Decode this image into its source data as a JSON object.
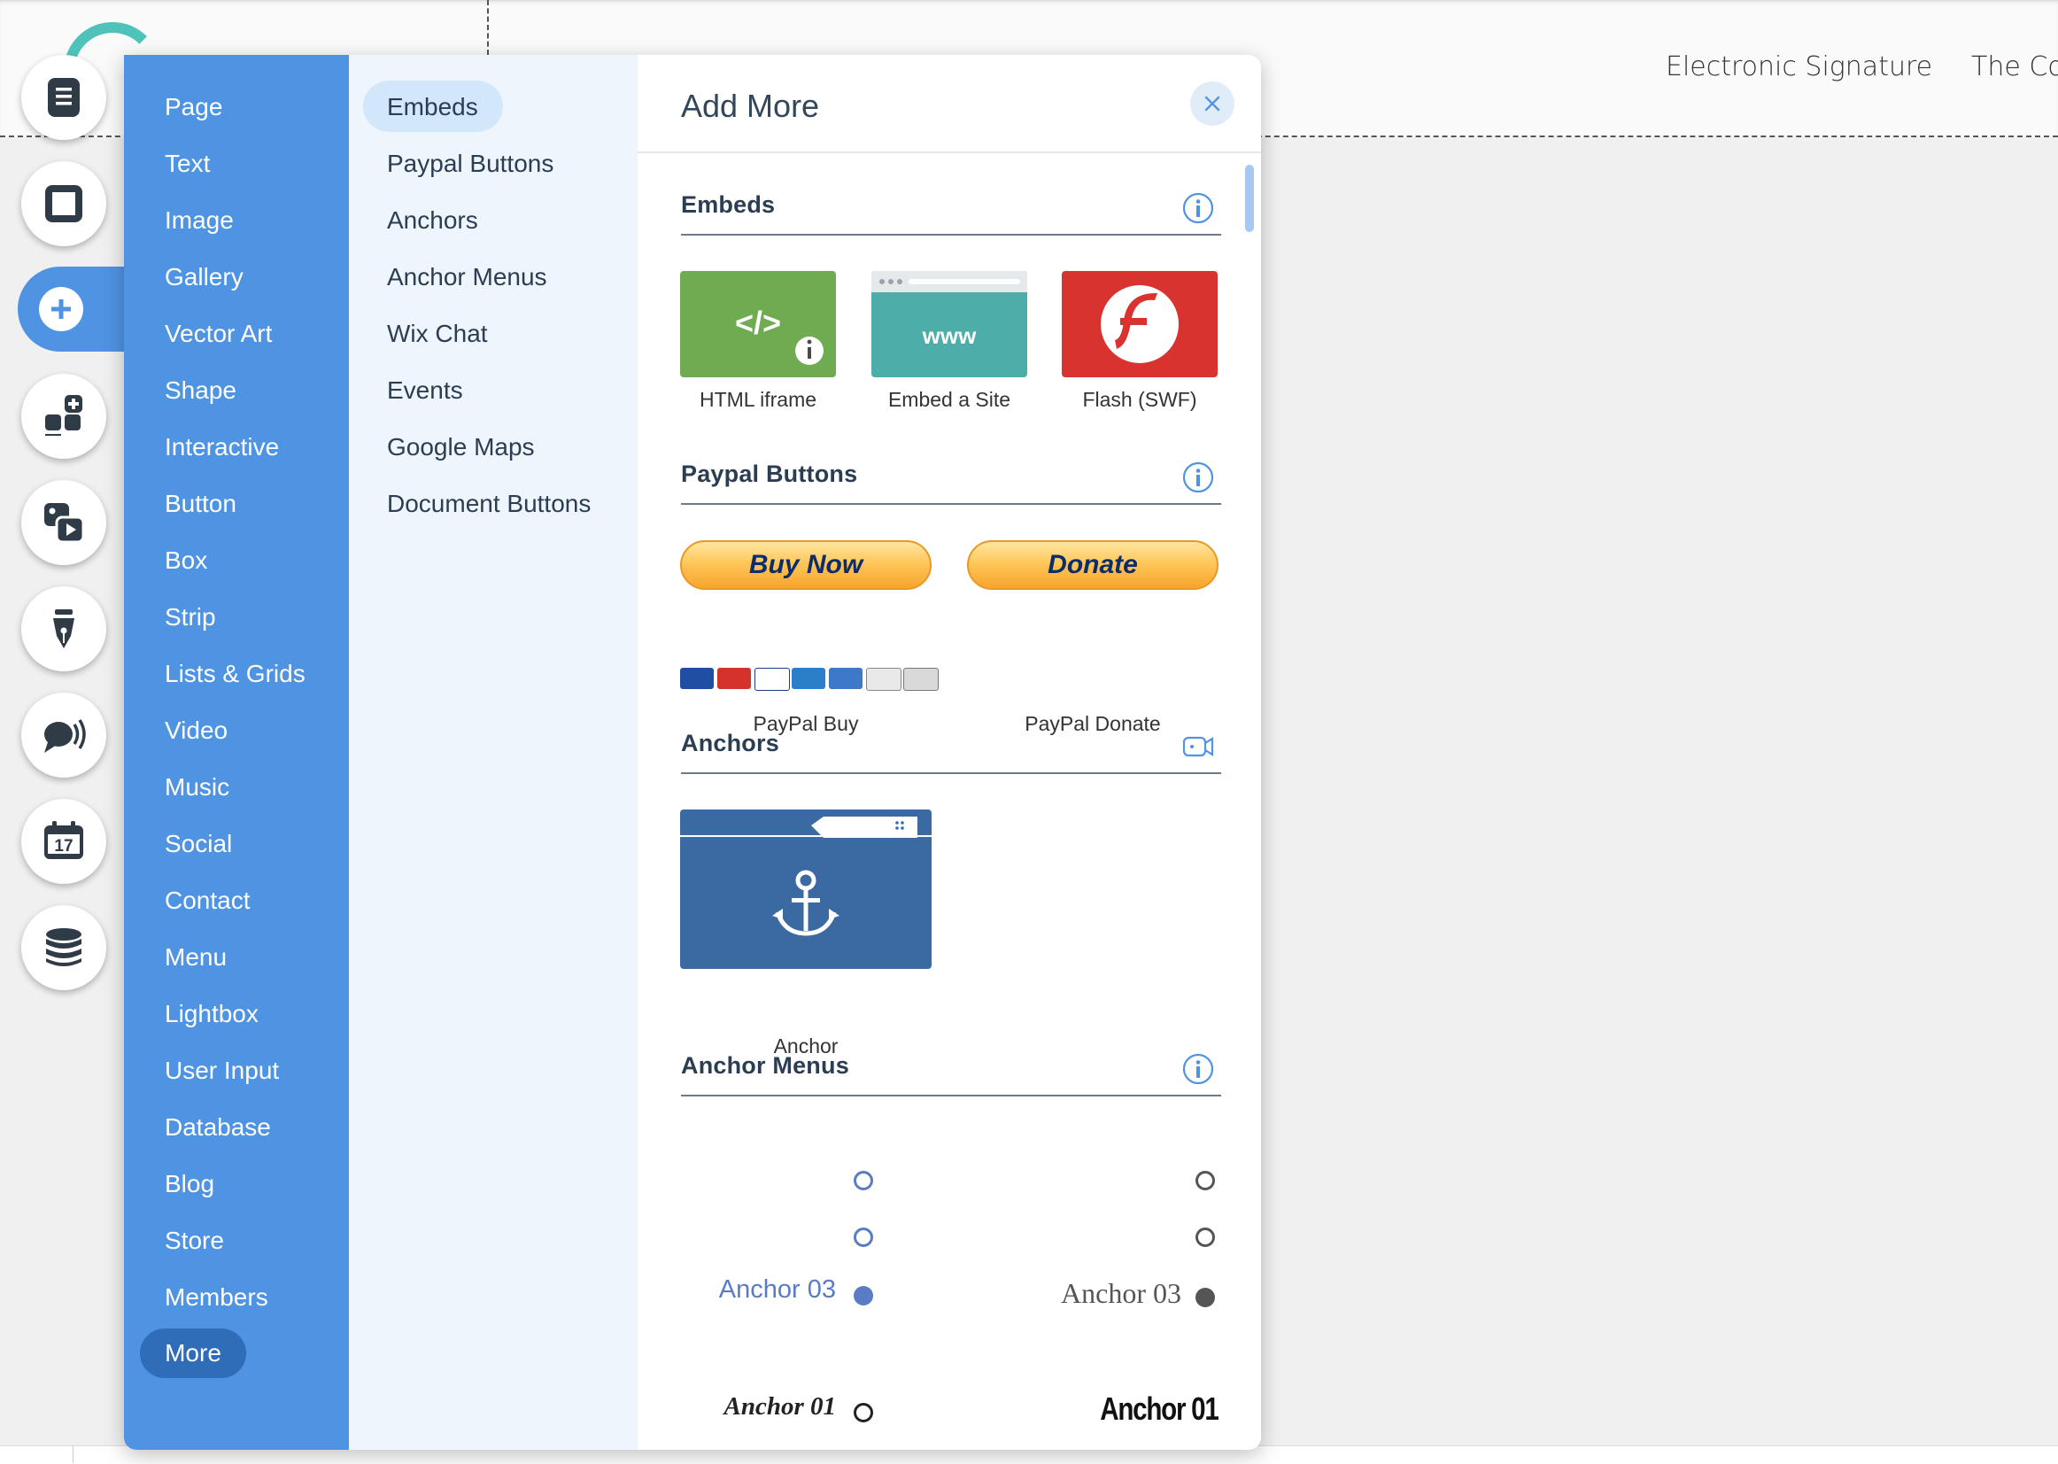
{
  "site": {
    "nav_links": [
      "Electronic Signature",
      "The Co"
    ]
  },
  "toolbar": {
    "buttons": [
      {
        "name": "pages-icon"
      },
      {
        "name": "background-icon"
      },
      {
        "name": "add-icon"
      },
      {
        "name": "add-apps-icon"
      },
      {
        "name": "media-icon"
      },
      {
        "name": "design-pen-icon"
      },
      {
        "name": "chat-icon"
      },
      {
        "name": "bookings-calendar-icon",
        "calendar_day": "17"
      },
      {
        "name": "database-icon"
      }
    ]
  },
  "panel": {
    "categories": [
      "Page",
      "Text",
      "Image",
      "Gallery",
      "Vector Art",
      "Shape",
      "Interactive",
      "Button",
      "Box",
      "Strip",
      "Lists & Grids",
      "Video",
      "Music",
      "Social",
      "Contact",
      "Menu",
      "Lightbox",
      "User Input",
      "Database",
      "Blog",
      "Store",
      "Members",
      "More"
    ],
    "active_category": "More",
    "subcategories": [
      "Embeds",
      "Paypal Buttons",
      "Anchors",
      "Anchor Menus",
      "Wix Chat",
      "Events",
      "Google Maps",
      "Document Buttons"
    ],
    "active_subcategory": "Embeds",
    "title": "Add More",
    "sections": {
      "embeds": {
        "title": "Embeds",
        "items": [
          {
            "label": "HTML iframe",
            "glyph": "</>",
            "color": "#6fab51"
          },
          {
            "label": "Embed a Site",
            "glyph": "www",
            "color": "#4dada8"
          },
          {
            "label": "Flash (SWF)",
            "glyph": "f",
            "color": "#d93330"
          }
        ]
      },
      "paypal": {
        "title": "Paypal Buttons",
        "items": [
          {
            "label": "PayPal Buy",
            "button_text": "Buy Now"
          },
          {
            "label": "PayPal Donate",
            "button_text": "Donate"
          }
        ]
      },
      "anchors": {
        "title": "Anchors",
        "items": [
          {
            "label": "Anchor"
          }
        ]
      },
      "anchor_menus": {
        "title": "Anchor Menus",
        "preview_1": {
          "label_3": "Anchor 03",
          "label_1": "Anchor 01"
        },
        "preview_2": {
          "label_3": "Anchor 03",
          "label_1": "Anchor 01"
        }
      }
    }
  },
  "colors": {
    "accent": "#4f93e3",
    "accent_dark": "#2f6db8",
    "sub_panel_bg": "#eef5fd",
    "text_dark": "#2b3d52"
  }
}
